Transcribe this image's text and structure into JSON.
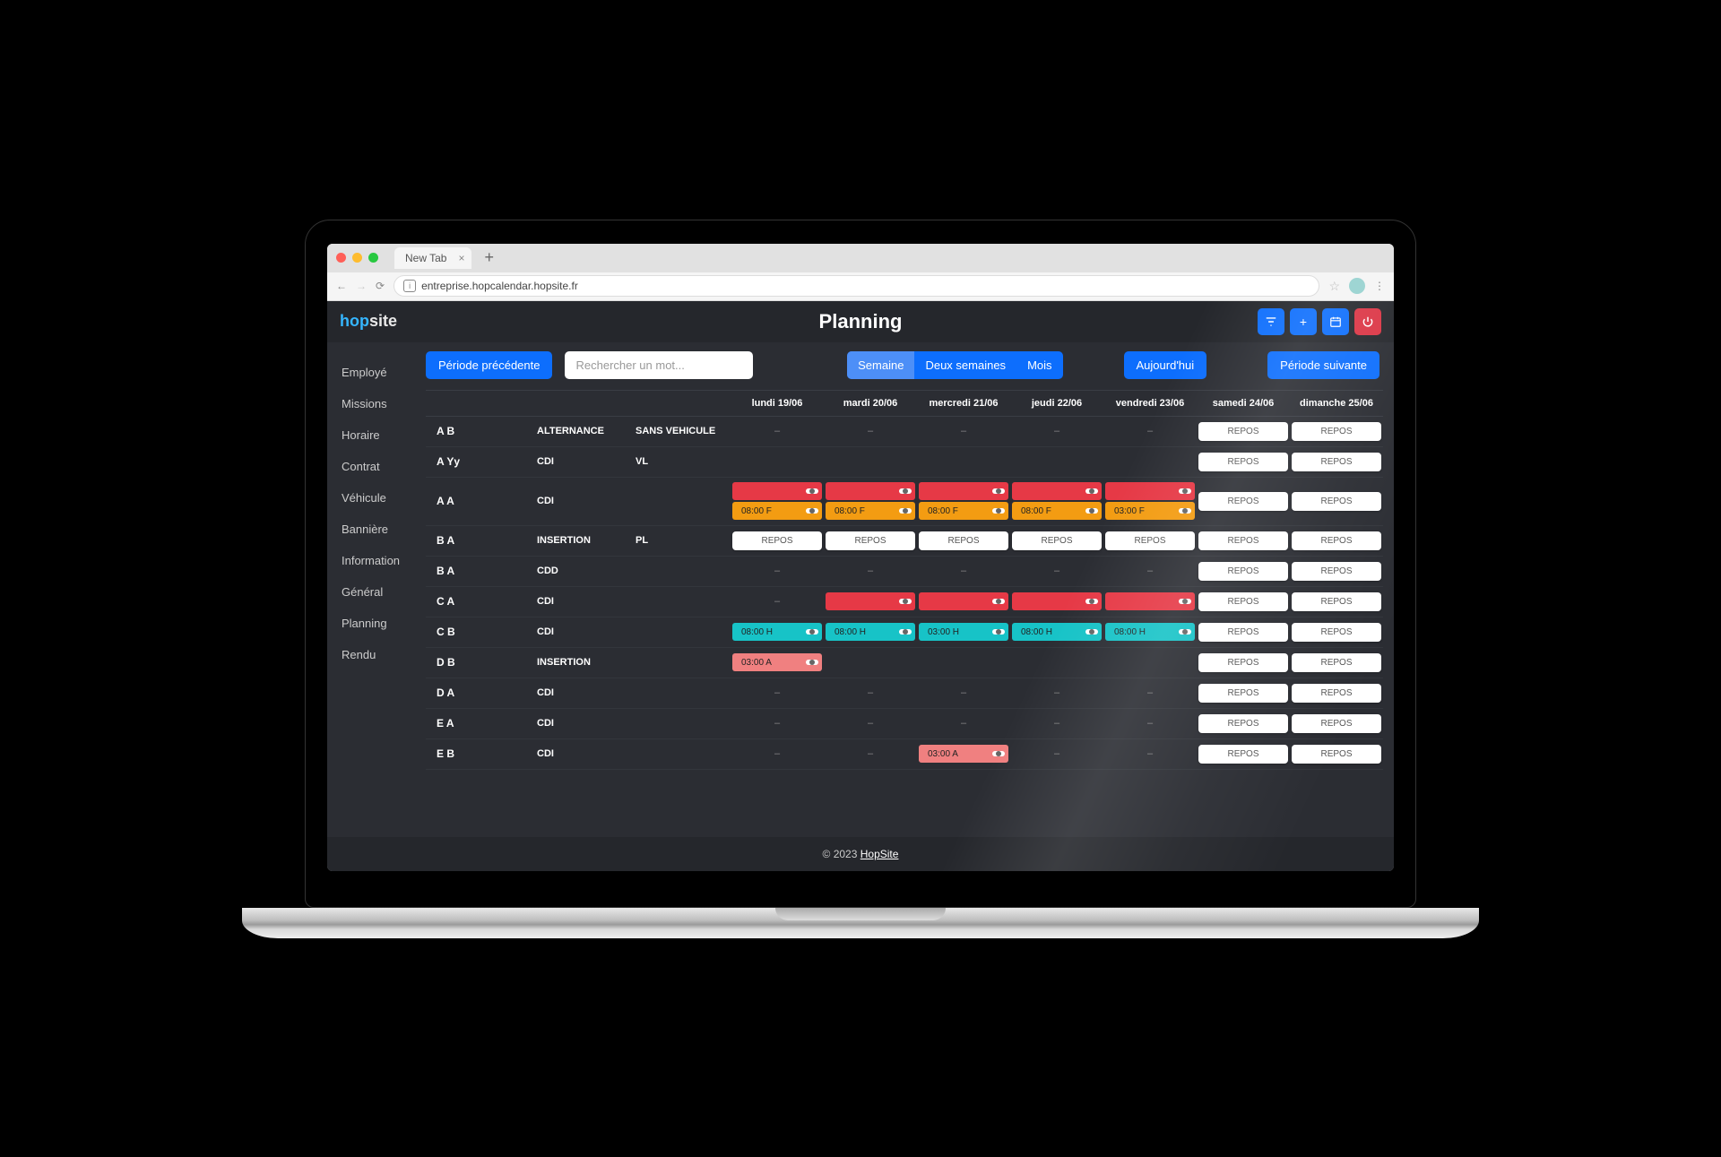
{
  "browser": {
    "tab_label": "New Tab",
    "url": "entreprise.hopcalendar.hopsite.fr"
  },
  "app": {
    "logo_a": "hop",
    "logo_b": "site",
    "title": "Planning",
    "header_icons": [
      "filter",
      "plus",
      "calendar",
      "power"
    ]
  },
  "sidebar": {
    "items": [
      "Employé",
      "Missions",
      "Horaire",
      "Contrat",
      "Véhicule",
      "Bannière",
      "Information",
      "Général",
      "Planning",
      "Rendu"
    ]
  },
  "toolbar": {
    "prev": "Période précédente",
    "search_placeholder": "Rechercher un mot...",
    "views": [
      "Semaine",
      "Deux semaines",
      "Mois"
    ],
    "active_view": 0,
    "today": "Aujourd'hui",
    "next": "Période suivante"
  },
  "columns": [
    "lundi 19/06",
    "mardi 20/06",
    "mercredi 21/06",
    "jeudi 22/06",
    "vendredi 23/06",
    "samedi 24/06",
    "dimanche 25/06"
  ],
  "repos": "REPOS",
  "rows": [
    {
      "name": "A B",
      "contract": "ALTERNANCE",
      "vehicle": "SANS VEHICULE",
      "cells": [
        {
          "t": "d"
        },
        {
          "t": "d"
        },
        {
          "t": "d"
        },
        {
          "t": "d"
        },
        {
          "t": "d"
        },
        {
          "t": "r"
        },
        {
          "t": "r"
        }
      ]
    },
    {
      "name": "A Yy",
      "contract": "CDI",
      "vehicle": "VL",
      "cells": [
        {
          "t": "e"
        },
        {
          "t": "e"
        },
        {
          "t": "e"
        },
        {
          "t": "e"
        },
        {
          "t": "e"
        },
        {
          "t": "r"
        },
        {
          "t": "r"
        }
      ]
    },
    {
      "name": "A A",
      "contract": "CDI",
      "vehicle": "",
      "tall": true,
      "cells": [
        {
          "t": "s",
          "chips": [
            {
              "c": "red",
              "txt": ""
            },
            {
              "c": "orange",
              "txt": "08:00 F"
            }
          ]
        },
        {
          "t": "s",
          "chips": [
            {
              "c": "red",
              "txt": ""
            },
            {
              "c": "orange",
              "txt": "08:00 F"
            }
          ]
        },
        {
          "t": "s",
          "chips": [
            {
              "c": "red",
              "txt": ""
            },
            {
              "c": "orange",
              "txt": "08:00 F"
            }
          ]
        },
        {
          "t": "s",
          "chips": [
            {
              "c": "red",
              "txt": ""
            },
            {
              "c": "orange",
              "txt": "08:00 F"
            }
          ]
        },
        {
          "t": "s",
          "chips": [
            {
              "c": "red",
              "txt": ""
            },
            {
              "c": "orange",
              "txt": "03:00 F"
            }
          ]
        },
        {
          "t": "r"
        },
        {
          "t": "r"
        }
      ]
    },
    {
      "name": "B A",
      "contract": "INSERTION",
      "vehicle": "PL",
      "cells": [
        {
          "t": "r"
        },
        {
          "t": "r"
        },
        {
          "t": "r"
        },
        {
          "t": "r"
        },
        {
          "t": "r"
        },
        {
          "t": "r"
        },
        {
          "t": "r"
        }
      ]
    },
    {
      "name": "B A",
      "contract": "CDD",
      "vehicle": "",
      "cells": [
        {
          "t": "d"
        },
        {
          "t": "d"
        },
        {
          "t": "d"
        },
        {
          "t": "d"
        },
        {
          "t": "d"
        },
        {
          "t": "r"
        },
        {
          "t": "r"
        }
      ]
    },
    {
      "name": "C A",
      "contract": "CDI",
      "vehicle": "",
      "cells": [
        {
          "t": "d"
        },
        {
          "t": "s",
          "chips": [
            {
              "c": "red",
              "txt": ""
            }
          ]
        },
        {
          "t": "s",
          "chips": [
            {
              "c": "red",
              "txt": ""
            }
          ]
        },
        {
          "t": "s",
          "chips": [
            {
              "c": "red",
              "txt": ""
            }
          ]
        },
        {
          "t": "s",
          "chips": [
            {
              "c": "red",
              "txt": ""
            }
          ]
        },
        {
          "t": "r"
        },
        {
          "t": "r"
        }
      ]
    },
    {
      "name": "C B",
      "contract": "CDI",
      "vehicle": "",
      "cells": [
        {
          "t": "s",
          "chips": [
            {
              "c": "cyan",
              "txt": "08:00 H"
            }
          ]
        },
        {
          "t": "s",
          "chips": [
            {
              "c": "cyan",
              "txt": "08:00 H"
            }
          ]
        },
        {
          "t": "s",
          "chips": [
            {
              "c": "cyan",
              "txt": "03:00 H"
            }
          ]
        },
        {
          "t": "s",
          "chips": [
            {
              "c": "cyan",
              "txt": "08:00 H"
            }
          ]
        },
        {
          "t": "s",
          "chips": [
            {
              "c": "cyan",
              "txt": "08:00 H"
            }
          ]
        },
        {
          "t": "r"
        },
        {
          "t": "r"
        }
      ]
    },
    {
      "name": "D B",
      "contract": "INSERTION",
      "vehicle": "",
      "cells": [
        {
          "t": "s",
          "chips": [
            {
              "c": "pink",
              "txt": "03:00 A"
            }
          ]
        },
        {
          "t": "e"
        },
        {
          "t": "e"
        },
        {
          "t": "e"
        },
        {
          "t": "e"
        },
        {
          "t": "r"
        },
        {
          "t": "r"
        }
      ]
    },
    {
      "name": "D A",
      "contract": "CDI",
      "vehicle": "",
      "cells": [
        {
          "t": "d"
        },
        {
          "t": "d"
        },
        {
          "t": "d"
        },
        {
          "t": "d"
        },
        {
          "t": "d"
        },
        {
          "t": "r"
        },
        {
          "t": "r"
        }
      ]
    },
    {
      "name": "E A",
      "contract": "CDI",
      "vehicle": "",
      "cells": [
        {
          "t": "d"
        },
        {
          "t": "d"
        },
        {
          "t": "d"
        },
        {
          "t": "d"
        },
        {
          "t": "d"
        },
        {
          "t": "r"
        },
        {
          "t": "r"
        }
      ]
    },
    {
      "name": "E B",
      "contract": "CDI",
      "vehicle": "",
      "cells": [
        {
          "t": "d"
        },
        {
          "t": "d"
        },
        {
          "t": "s",
          "chips": [
            {
              "c": "pink",
              "txt": "03:00 A"
            }
          ]
        },
        {
          "t": "d"
        },
        {
          "t": "d"
        },
        {
          "t": "r"
        },
        {
          "t": "r"
        }
      ]
    }
  ],
  "footer": {
    "copy": "© 2023 ",
    "link": "HopSite"
  }
}
